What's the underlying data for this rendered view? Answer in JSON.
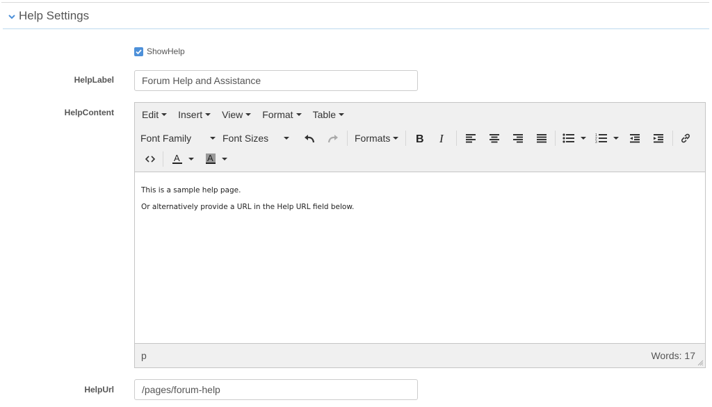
{
  "section": {
    "title": "Help Settings"
  },
  "show_help": {
    "label": "ShowHelp",
    "checked": true
  },
  "help_label": {
    "label": "HelpLabel",
    "value": "Forum Help and Assistance"
  },
  "help_content": {
    "label": "HelpContent",
    "menubar": [
      "Edit",
      "Insert",
      "View",
      "Format",
      "Table"
    ],
    "toolbar": {
      "font_family": "Font Family",
      "font_sizes": "Font Sizes",
      "formats": "Formats"
    },
    "content_lines": [
      "This is a sample help page.",
      "Or alternatively provide a URL in the Help URL field below."
    ],
    "status_path": "p",
    "word_count": "Words: 17"
  },
  "help_url": {
    "label": "HelpUrl",
    "value": "/pages/forum-help"
  },
  "colors": {
    "accent": "#4d90d9",
    "header_border": "#bcd9ef"
  }
}
